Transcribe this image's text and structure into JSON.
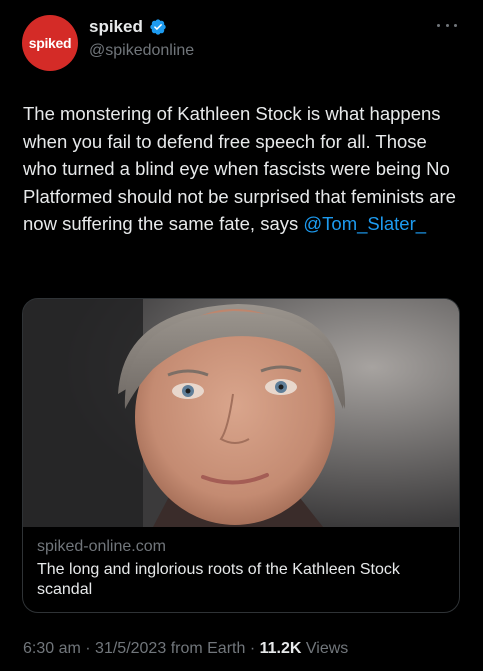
{
  "account": {
    "display_name": "spiked",
    "handle": "@spikedonline",
    "avatar_text": "spiked",
    "avatar_color": "#d42b27",
    "verified": true
  },
  "tweet": {
    "text_before": "The monstering of Kathleen Stock is what happens when you fail to defend free speech for all. Those who turned a blind eye when fascists were being No Platformed should not be surprised that feminists are now suffering the same fate, says ",
    "mention": "@Tom_Slater_"
  },
  "card": {
    "domain": "spiked-online.com",
    "title": "The long and inglorious roots of the Kathleen Stock scandal"
  },
  "footer": {
    "time": "6:30 am",
    "separator": "·",
    "date": "31/5/2023",
    "source": "from Earth",
    "views_count": "11.2K",
    "views_label": "Views"
  },
  "colors": {
    "background": "#000000",
    "text": "#e7e9ea",
    "secondary": "#71767b",
    "link": "#1d9bf0",
    "verified": "#1d9bf0"
  },
  "icons": {
    "verified": "verified-badge-icon",
    "more": "more-options-icon"
  }
}
